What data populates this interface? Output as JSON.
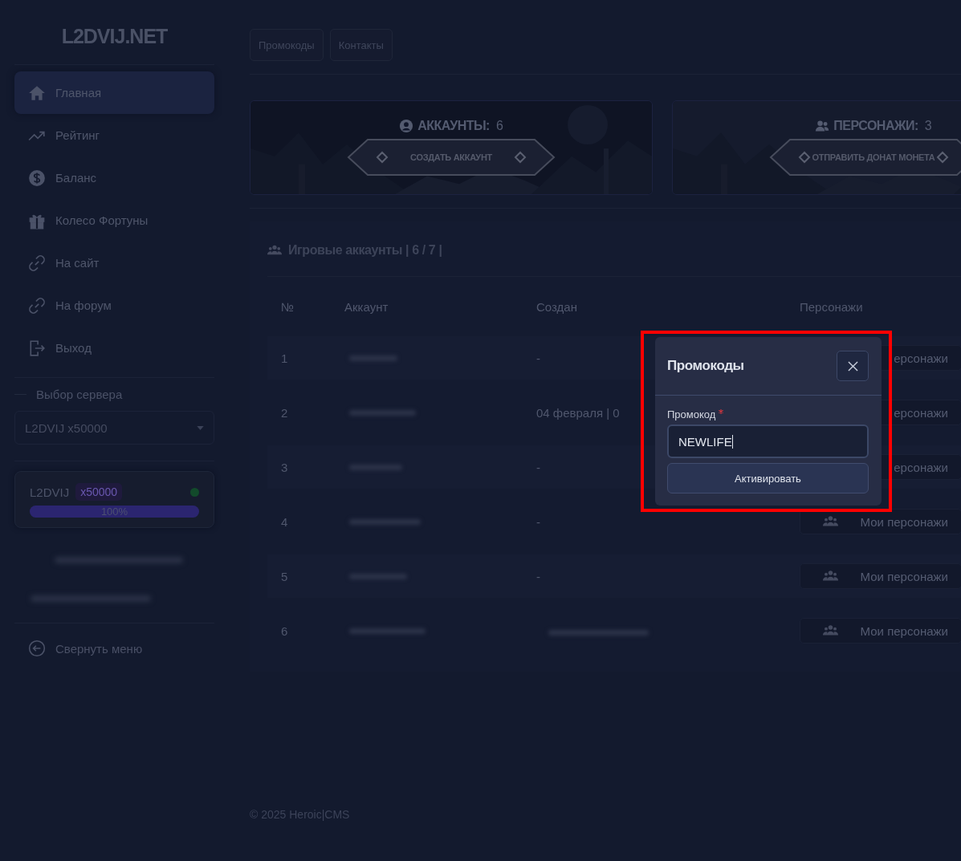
{
  "logo": "L2DVIJ.NET",
  "sidebar": {
    "items": [
      {
        "label": "Главная",
        "selected": true
      },
      {
        "label": "Рейтинг",
        "selected": false
      },
      {
        "label": "Баланс",
        "selected": false
      },
      {
        "label": "Колесо Фортуны",
        "selected": false
      },
      {
        "label": "На сайт",
        "selected": false
      },
      {
        "label": "На форум",
        "selected": false
      },
      {
        "label": "Выход",
        "selected": false
      }
    ]
  },
  "server_select": {
    "label": "Выбор сервера",
    "value": "L2DVIJ x50000"
  },
  "server_status": {
    "name": "L2DVIJ",
    "rate": "x50000",
    "online": true,
    "level": 1,
    "reading": "100%"
  },
  "collapse": "Свернуть меню",
  "top_buttons": [
    "Промокоды",
    "Контакты"
  ],
  "cards": [
    {
      "title": "АККАУНТЫ:",
      "count": "6",
      "button": "СОЗДАТЬ АККАУНТ"
    },
    {
      "title": "ПЕРСОНАЖИ:",
      "count": "3",
      "button": "ОТПРАВИТЬ ДОНАТ МОНЕТА"
    }
  ],
  "accounts": {
    "title": "Игровые аккаунты | 6 / 7 |",
    "columns": [
      "№",
      "Аккаунт",
      "Создан",
      "Персонажи"
    ],
    "rows": [
      {
        "number": "1",
        "created": "-",
        "action": "ерсонажи"
      },
      {
        "number": "2",
        "created": "04 февраля | 0",
        "action": "ерсонажи"
      },
      {
        "number": "3",
        "created": "-",
        "action": "ерсонажи"
      },
      {
        "number": "4",
        "created": "-",
        "action": "Мои персонажи",
        "icon": true
      },
      {
        "number": "5",
        "created": "-",
        "action": "Мои персонажи",
        "icon": true
      },
      {
        "number": "6",
        "created_redacted": true,
        "action": "Мои персонажи",
        "icon": true
      }
    ]
  },
  "footer": "© 2025 Heroic|CMS",
  "modal": {
    "title": "Промокоды",
    "field_label": "Промокод",
    "required": true,
    "value": "NEWLIFE",
    "button": "Активировать",
    "highlighted": true
  }
}
